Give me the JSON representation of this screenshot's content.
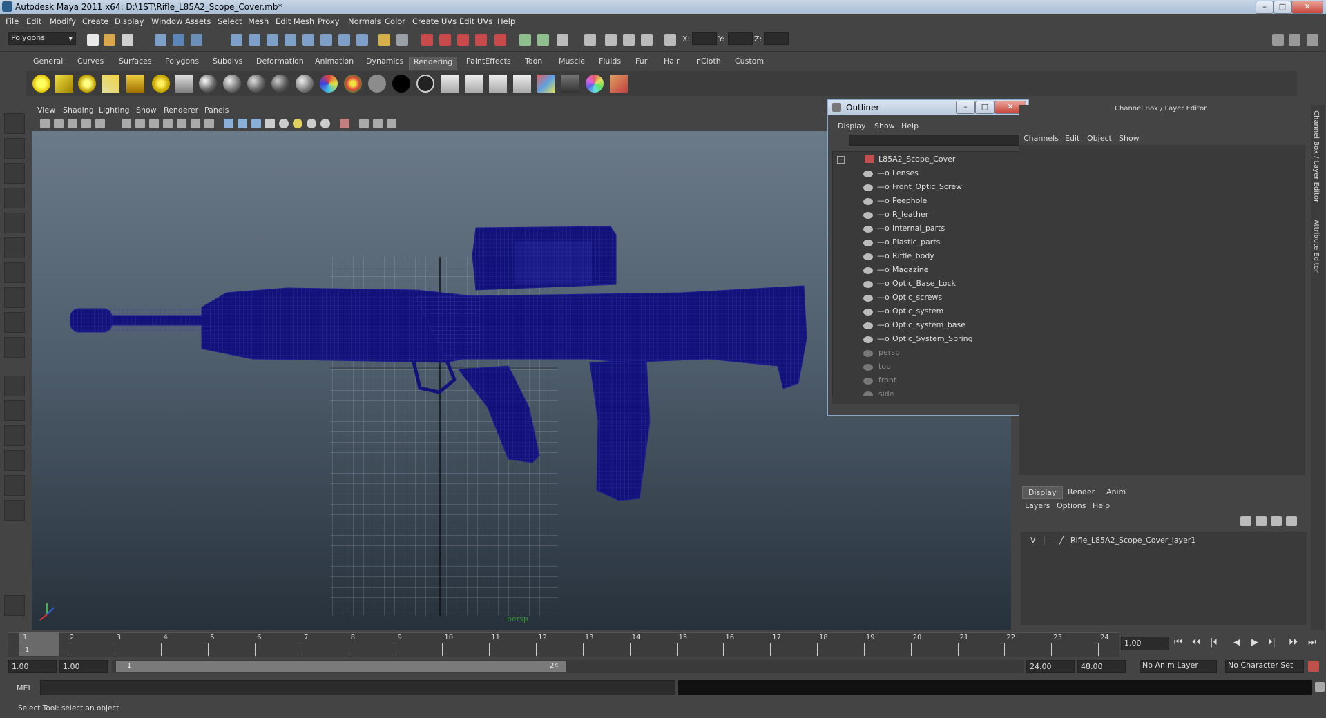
{
  "window": {
    "title": "Autodesk Maya 2011 x64: D:\\1ST\\Rifle_L85A2_Scope_Cover.mb*"
  },
  "menus": [
    "File",
    "Edit",
    "Modify",
    "Create",
    "Display",
    "Window",
    "Assets",
    "Select",
    "Mesh",
    "Edit Mesh",
    "Proxy",
    "Normals",
    "Color",
    "Create UVs",
    "Edit UVs",
    "Help"
  ],
  "statusline": {
    "mode": "Polygons",
    "x_label": "X:",
    "y_label": "Y:",
    "z_label": "Z:"
  },
  "shelf_tabs": [
    "General",
    "Curves",
    "Surfaces",
    "Polygons",
    "Subdivs",
    "Deformation",
    "Animation",
    "Dynamics",
    "Rendering",
    "PaintEffects",
    "Toon",
    "Muscle",
    "Fluids",
    "Fur",
    "Hair",
    "nCloth",
    "Custom"
  ],
  "active_shelf": "Rendering",
  "viewport": {
    "menus": [
      "View",
      "Shading",
      "Lighting",
      "Show",
      "Renderer",
      "Panels"
    ],
    "camera_label": "persp",
    "wire_color": "#12127a"
  },
  "outliner": {
    "title": "Outliner",
    "menus": [
      "Display",
      "Show",
      "Help"
    ],
    "root": "L85A2_Scope_Cover",
    "children": [
      "Lenses",
      "Front_Optic_Screw",
      "Peephole",
      "R_leather",
      "Internal_parts",
      "Plastic_parts",
      "Riffle_body",
      "Magazine",
      "Optic_Base_Lock",
      "Optic_screws",
      "Optic_system",
      "Optic_system_base",
      "Optic_System_Spring"
    ],
    "cameras": [
      "persp",
      "top",
      "front",
      "side"
    ]
  },
  "channel_box": {
    "title": "Channel Box / Layer Editor",
    "menus": [
      "Channels",
      "Edit",
      "Object",
      "Show"
    ],
    "side_tabs": [
      "Channel Box / Layer Editor",
      "Attribute Editor"
    ]
  },
  "layer_editor": {
    "tabs": [
      "Display",
      "Render",
      "Anim"
    ],
    "active_tab": "Display",
    "menus": [
      "Layers",
      "Options",
      "Help"
    ],
    "layer_visible": "V",
    "layer_name": "Rifle_L85A2_Scope_Cover_layer1"
  },
  "timeline": {
    "ticks": [
      "1",
      "2",
      "3",
      "4",
      "5",
      "6",
      "7",
      "8",
      "9",
      "10",
      "11",
      "12",
      "13",
      "14",
      "15",
      "16",
      "17",
      "18",
      "19",
      "20",
      "21",
      "22",
      "23",
      "24"
    ],
    "current_frame": "1",
    "current_time_field": "1.00"
  },
  "range": {
    "start_time": "1.00",
    "start_range": "1.00",
    "range_start_label": "1",
    "range_end_label": "24",
    "end_range": "24.00",
    "end_time": "48.00",
    "anim_layer": "No Anim Layer",
    "character_set": "No Character Set"
  },
  "command_line": {
    "label": "MEL"
  },
  "help_line": {
    "text": "Select Tool: select an object"
  }
}
